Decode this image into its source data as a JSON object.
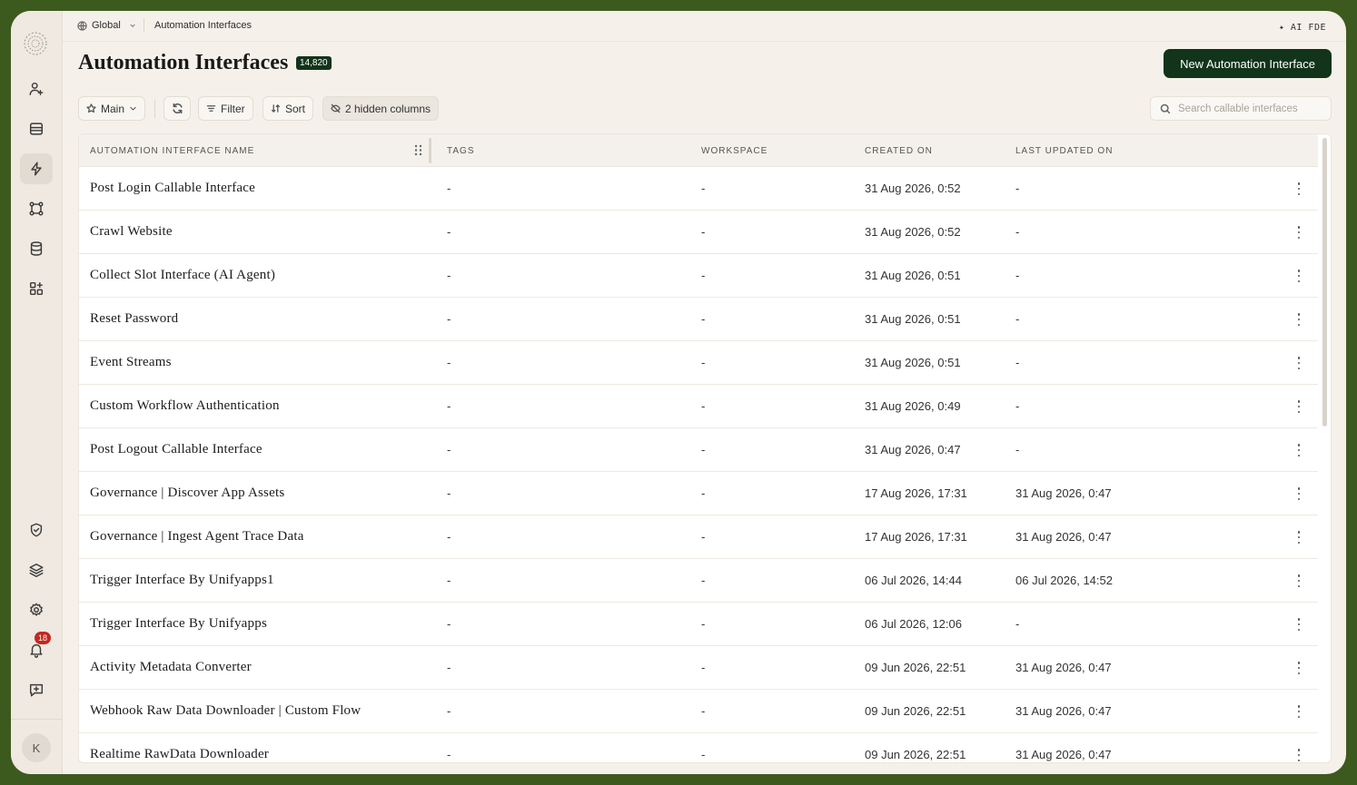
{
  "sidebar": {
    "items": [
      {
        "name": "users-icon"
      },
      {
        "name": "inbox-icon"
      },
      {
        "name": "automation-icon",
        "active": true
      },
      {
        "name": "workflow-icon"
      },
      {
        "name": "database-icon"
      },
      {
        "name": "apps-icon"
      },
      {
        "name": "shield-icon"
      },
      {
        "name": "layers-icon"
      },
      {
        "name": "gear-icon"
      },
      {
        "name": "bell-icon"
      },
      {
        "name": "feedback-icon"
      }
    ],
    "notification_count": "18",
    "avatar_initial": "K"
  },
  "topbar": {
    "scope": "Global",
    "breadcrumb": "Automation Interfaces",
    "ai_label": "AI FDE"
  },
  "page": {
    "title": "Automation Interfaces",
    "count": "14,820",
    "new_button": "New Automation Interface"
  },
  "toolbar": {
    "view": "Main",
    "filter": "Filter",
    "sort": "Sort",
    "hidden_columns": "2 hidden columns",
    "search_placeholder": "Search callable interfaces"
  },
  "table": {
    "columns": [
      "AUTOMATION INTERFACE NAME",
      "TAGS",
      "WORKSPACE",
      "CREATED ON",
      "LAST UPDATED ON"
    ],
    "rows": [
      {
        "name": "Post Login Callable Interface",
        "tags": "-",
        "workspace": "-",
        "created": "31 Aug 2026, 0:52",
        "updated": "-"
      },
      {
        "name": "Crawl Website",
        "tags": "-",
        "workspace": "-",
        "created": "31 Aug 2026, 0:52",
        "updated": "-"
      },
      {
        "name": "Collect Slot Interface (AI Agent)",
        "tags": "-",
        "workspace": "-",
        "created": "31 Aug 2026, 0:51",
        "updated": "-"
      },
      {
        "name": "Reset Password",
        "tags": "-",
        "workspace": "-",
        "created": "31 Aug 2026, 0:51",
        "updated": "-"
      },
      {
        "name": "Event Streams",
        "tags": "-",
        "workspace": "-",
        "created": "31 Aug 2026, 0:51",
        "updated": "-"
      },
      {
        "name": "Custom Workflow Authentication",
        "tags": "-",
        "workspace": "-",
        "created": "31 Aug 2026, 0:49",
        "updated": "-"
      },
      {
        "name": "Post Logout Callable Interface",
        "tags": "-",
        "workspace": "-",
        "created": "31 Aug 2026, 0:47",
        "updated": "-"
      },
      {
        "name": "Governance | Discover App Assets",
        "tags": "-",
        "workspace": "-",
        "created": "17 Aug 2026, 17:31",
        "updated": "31 Aug 2026, 0:47"
      },
      {
        "name": "Governance | Ingest Agent Trace Data",
        "tags": "-",
        "workspace": "-",
        "created": "17 Aug 2026, 17:31",
        "updated": "31 Aug 2026, 0:47"
      },
      {
        "name": "Trigger Interface By Unifyapps1",
        "tags": "-",
        "workspace": "-",
        "created": "06 Jul 2026, 14:44",
        "updated": "06 Jul 2026, 14:52"
      },
      {
        "name": "Trigger Interface By Unifyapps",
        "tags": "-",
        "workspace": "-",
        "created": "06 Jul 2026, 12:06",
        "updated": "-"
      },
      {
        "name": "Activity Metadata Converter",
        "tags": "-",
        "workspace": "-",
        "created": "09 Jun 2026, 22:51",
        "updated": "31 Aug 2026, 0:47"
      },
      {
        "name": "Webhook Raw Data Downloader | Custom Flow",
        "tags": "-",
        "workspace": "-",
        "created": "09 Jun 2026, 22:51",
        "updated": "31 Aug 2026, 0:47"
      },
      {
        "name": "Realtime RawData Downloader",
        "tags": "-",
        "workspace": "-",
        "created": "09 Jun 2026, 22:51",
        "updated": "31 Aug 2026, 0:47"
      }
    ]
  }
}
